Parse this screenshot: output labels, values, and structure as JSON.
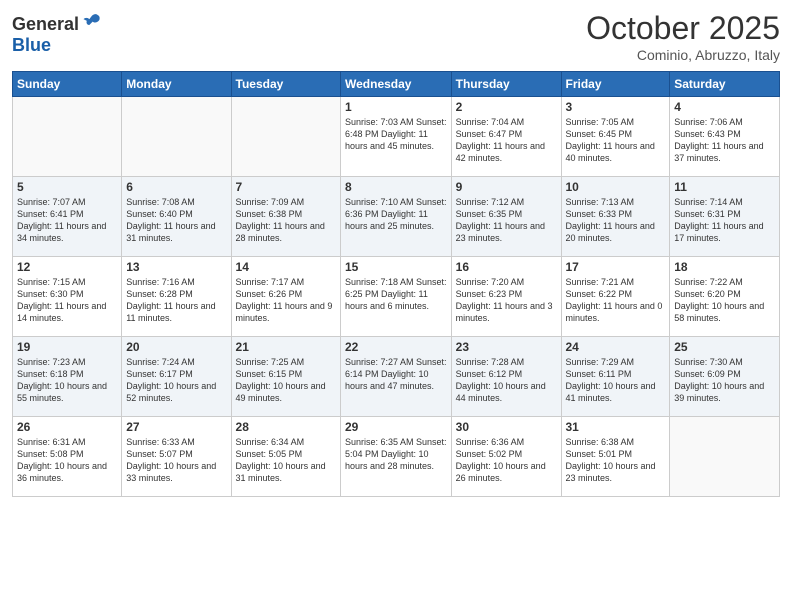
{
  "header": {
    "logo_general": "General",
    "logo_blue": "Blue",
    "month": "October 2025",
    "location": "Cominio, Abruzzo, Italy"
  },
  "days_of_week": [
    "Sunday",
    "Monday",
    "Tuesday",
    "Wednesday",
    "Thursday",
    "Friday",
    "Saturday"
  ],
  "weeks": [
    [
      {
        "day": "",
        "info": ""
      },
      {
        "day": "",
        "info": ""
      },
      {
        "day": "",
        "info": ""
      },
      {
        "day": "1",
        "info": "Sunrise: 7:03 AM\nSunset: 6:48 PM\nDaylight: 11 hours and 45 minutes."
      },
      {
        "day": "2",
        "info": "Sunrise: 7:04 AM\nSunset: 6:47 PM\nDaylight: 11 hours and 42 minutes."
      },
      {
        "day": "3",
        "info": "Sunrise: 7:05 AM\nSunset: 6:45 PM\nDaylight: 11 hours and 40 minutes."
      },
      {
        "day": "4",
        "info": "Sunrise: 7:06 AM\nSunset: 6:43 PM\nDaylight: 11 hours and 37 minutes."
      }
    ],
    [
      {
        "day": "5",
        "info": "Sunrise: 7:07 AM\nSunset: 6:41 PM\nDaylight: 11 hours and 34 minutes."
      },
      {
        "day": "6",
        "info": "Sunrise: 7:08 AM\nSunset: 6:40 PM\nDaylight: 11 hours and 31 minutes."
      },
      {
        "day": "7",
        "info": "Sunrise: 7:09 AM\nSunset: 6:38 PM\nDaylight: 11 hours and 28 minutes."
      },
      {
        "day": "8",
        "info": "Sunrise: 7:10 AM\nSunset: 6:36 PM\nDaylight: 11 hours and 25 minutes."
      },
      {
        "day": "9",
        "info": "Sunrise: 7:12 AM\nSunset: 6:35 PM\nDaylight: 11 hours and 23 minutes."
      },
      {
        "day": "10",
        "info": "Sunrise: 7:13 AM\nSunset: 6:33 PM\nDaylight: 11 hours and 20 minutes."
      },
      {
        "day": "11",
        "info": "Sunrise: 7:14 AM\nSunset: 6:31 PM\nDaylight: 11 hours and 17 minutes."
      }
    ],
    [
      {
        "day": "12",
        "info": "Sunrise: 7:15 AM\nSunset: 6:30 PM\nDaylight: 11 hours and 14 minutes."
      },
      {
        "day": "13",
        "info": "Sunrise: 7:16 AM\nSunset: 6:28 PM\nDaylight: 11 hours and 11 minutes."
      },
      {
        "day": "14",
        "info": "Sunrise: 7:17 AM\nSunset: 6:26 PM\nDaylight: 11 hours and 9 minutes."
      },
      {
        "day": "15",
        "info": "Sunrise: 7:18 AM\nSunset: 6:25 PM\nDaylight: 11 hours and 6 minutes."
      },
      {
        "day": "16",
        "info": "Sunrise: 7:20 AM\nSunset: 6:23 PM\nDaylight: 11 hours and 3 minutes."
      },
      {
        "day": "17",
        "info": "Sunrise: 7:21 AM\nSunset: 6:22 PM\nDaylight: 11 hours and 0 minutes."
      },
      {
        "day": "18",
        "info": "Sunrise: 7:22 AM\nSunset: 6:20 PM\nDaylight: 10 hours and 58 minutes."
      }
    ],
    [
      {
        "day": "19",
        "info": "Sunrise: 7:23 AM\nSunset: 6:18 PM\nDaylight: 10 hours and 55 minutes."
      },
      {
        "day": "20",
        "info": "Sunrise: 7:24 AM\nSunset: 6:17 PM\nDaylight: 10 hours and 52 minutes."
      },
      {
        "day": "21",
        "info": "Sunrise: 7:25 AM\nSunset: 6:15 PM\nDaylight: 10 hours and 49 minutes."
      },
      {
        "day": "22",
        "info": "Sunrise: 7:27 AM\nSunset: 6:14 PM\nDaylight: 10 hours and 47 minutes."
      },
      {
        "day": "23",
        "info": "Sunrise: 7:28 AM\nSunset: 6:12 PM\nDaylight: 10 hours and 44 minutes."
      },
      {
        "day": "24",
        "info": "Sunrise: 7:29 AM\nSunset: 6:11 PM\nDaylight: 10 hours and 41 minutes."
      },
      {
        "day": "25",
        "info": "Sunrise: 7:30 AM\nSunset: 6:09 PM\nDaylight: 10 hours and 39 minutes."
      }
    ],
    [
      {
        "day": "26",
        "info": "Sunrise: 6:31 AM\nSunset: 5:08 PM\nDaylight: 10 hours and 36 minutes."
      },
      {
        "day": "27",
        "info": "Sunrise: 6:33 AM\nSunset: 5:07 PM\nDaylight: 10 hours and 33 minutes."
      },
      {
        "day": "28",
        "info": "Sunrise: 6:34 AM\nSunset: 5:05 PM\nDaylight: 10 hours and 31 minutes."
      },
      {
        "day": "29",
        "info": "Sunrise: 6:35 AM\nSunset: 5:04 PM\nDaylight: 10 hours and 28 minutes."
      },
      {
        "day": "30",
        "info": "Sunrise: 6:36 AM\nSunset: 5:02 PM\nDaylight: 10 hours and 26 minutes."
      },
      {
        "day": "31",
        "info": "Sunrise: 6:38 AM\nSunset: 5:01 PM\nDaylight: 10 hours and 23 minutes."
      },
      {
        "day": "",
        "info": ""
      }
    ]
  ]
}
